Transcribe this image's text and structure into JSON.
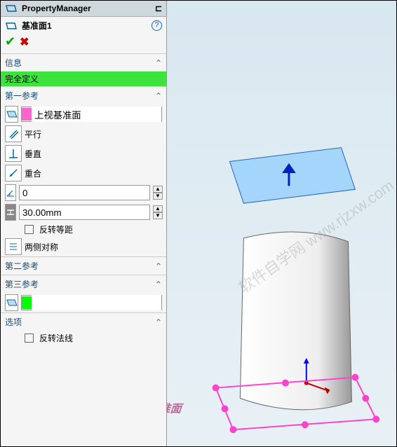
{
  "header": {
    "title": "PropertyManager"
  },
  "feature": {
    "icon": "plane",
    "name": "基准面1"
  },
  "sections": {
    "info": {
      "title": "信息",
      "status": "完全定义"
    },
    "ref1": {
      "title": "第一参考",
      "entity": "上视基准面",
      "parallel": "平行",
      "perpendicular": "垂直",
      "coincident": "重合",
      "angle": "0",
      "offset": "30.00mm",
      "flip_offset": "反转等距",
      "midplane": "两侧对称"
    },
    "ref2": {
      "title": "第二参考"
    },
    "ref3": {
      "title": "第三参考",
      "entity": ""
    },
    "options": {
      "title": "选项",
      "flip_normal": "反转法线"
    }
  }
}
